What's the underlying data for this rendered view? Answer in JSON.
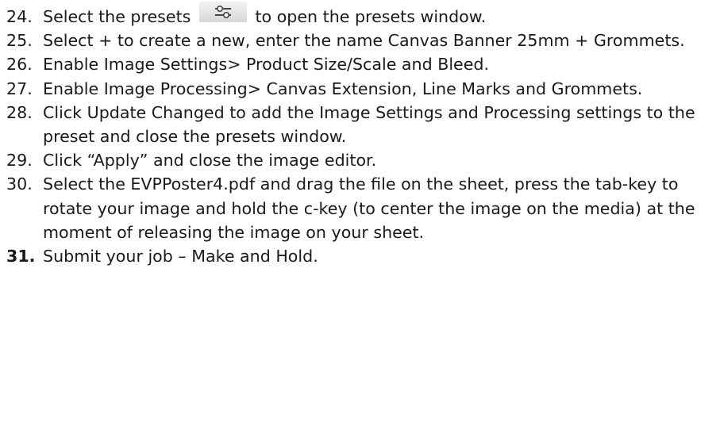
{
  "steps": [
    {
      "number": "24.",
      "text_before_icon": "Select the presets",
      "icon": "presets-sliders-icon",
      "text_after_icon": "to open the presets window."
    },
    {
      "number": "25.",
      "text": "Select + to create a new, enter the name Canvas Banner 25mm + Grommets."
    },
    {
      "number": "26.",
      "text": "Enable Image Settings> Product Size/Scale and Bleed."
    },
    {
      "number": "27.",
      "text": "Enable Image Processing> Canvas Extension, Line Marks and Grommets."
    },
    {
      "number": "28.",
      "text": "Click Update Changed to add the Image Settings and Processing settings to the preset and close the presets window."
    },
    {
      "number": "29.",
      "text": "Click “Apply” and close the image editor."
    },
    {
      "number": "30.",
      "text": "Select the EVPPoster4.pdf and drag the file on the sheet, press the tab-key to rotate your image and hold the c-key (to center the image on the media) at the moment of releasing the image on your sheet."
    },
    {
      "number": "31.",
      "text": "Submit your job – Make and Hold."
    }
  ]
}
